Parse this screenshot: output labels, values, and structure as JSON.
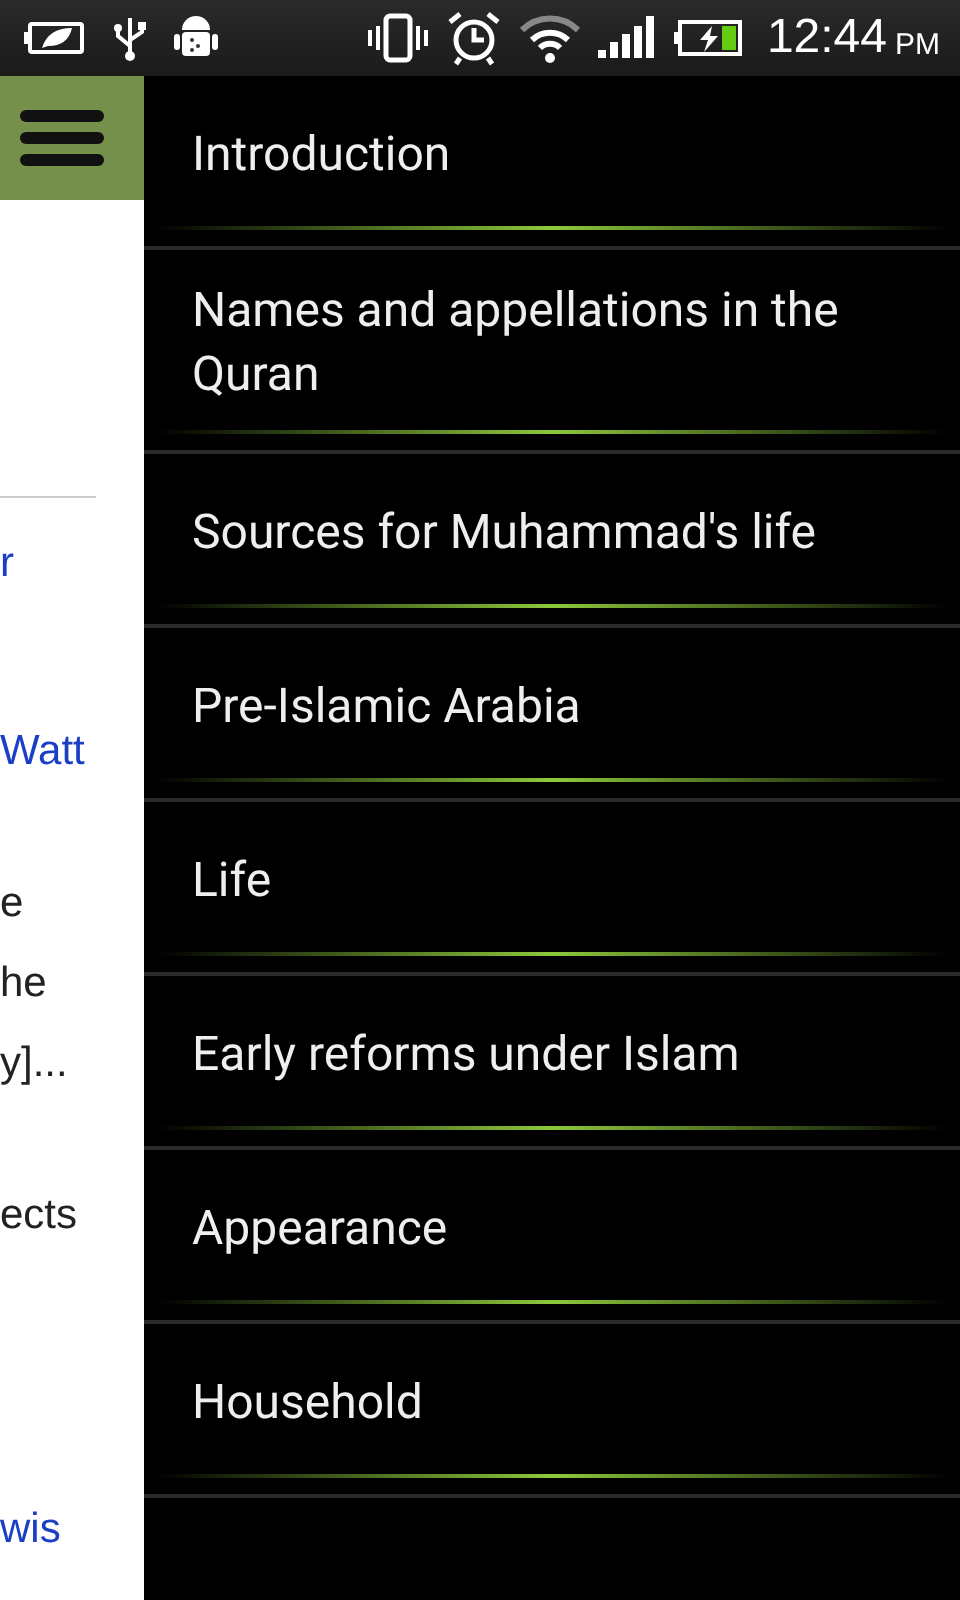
{
  "status_bar": {
    "time": "12:44",
    "meridiem": "PM"
  },
  "page_snippets": [
    {
      "text": "r",
      "kind": "link"
    },
    {
      "text": "Watt",
      "kind": "link"
    },
    {
      "text": "e",
      "kind": "text"
    },
    {
      "text": "he",
      "kind": "text"
    },
    {
      "text": "y]...",
      "kind": "text"
    },
    {
      "text": "ects",
      "kind": "text"
    },
    {
      "text": "wis",
      "kind": "link"
    }
  ],
  "drawer": {
    "items": [
      {
        "label": "Introduction"
      },
      {
        "label": "Names and appellations in the Quran"
      },
      {
        "label": "Sources for Muhammad's life"
      },
      {
        "label": "Pre-Islamic Arabia"
      },
      {
        "label": "Life"
      },
      {
        "label": "Early reforms under Islam"
      },
      {
        "label": "Appearance"
      },
      {
        "label": "Household"
      }
    ]
  }
}
